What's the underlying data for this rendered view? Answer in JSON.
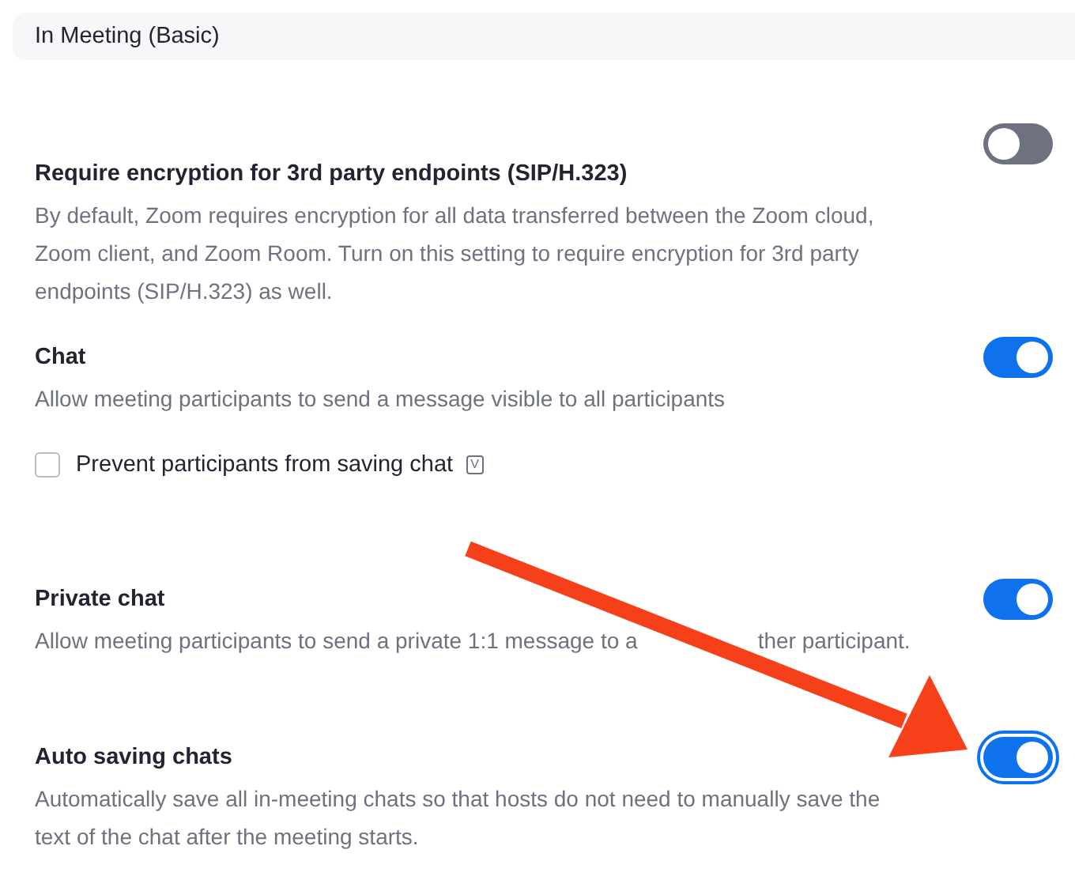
{
  "section": {
    "title": "In Meeting (Basic)"
  },
  "settings": [
    {
      "title": "Require encryption for 3rd party endpoints (SIP/H.323)",
      "description": "By default, Zoom requires encryption for all data transferred between the Zoom cloud, Zoom client, and Zoom Room. Turn on this setting to require encryption for 3rd party endpoints (SIP/H.323) as well.",
      "on": false,
      "focused": false
    },
    {
      "title": "Chat",
      "description": "Allow meeting participants to send a message visible to all participants",
      "on": true,
      "focused": false,
      "options": [
        {
          "label": "Prevent participants from saving chat",
          "checked": false,
          "badge": "V"
        }
      ]
    },
    {
      "title": "Private chat",
      "description_parts": [
        "Allow meeting participants to send a private 1:1 message to a",
        "ther participant."
      ],
      "on": true,
      "focused": false
    },
    {
      "title": "Auto saving chats",
      "description": "Automatically save all in-meeting chats so that hosts do not need to manually save the text of the chat after the meeting starts.",
      "on": true,
      "focused": true
    }
  ]
}
